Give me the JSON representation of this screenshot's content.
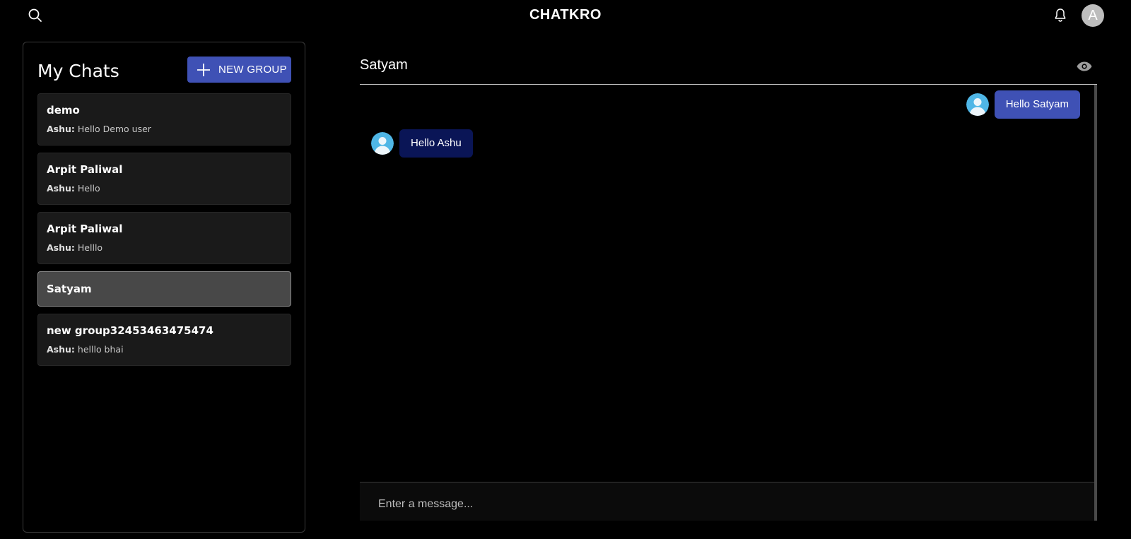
{
  "app": {
    "title": "CHATKRO",
    "avatar_letter": "A"
  },
  "sidebar": {
    "title": "My Chats",
    "new_group_label": "NEW GROUP",
    "chats": [
      {
        "name": "demo",
        "sender": "Ashu:",
        "preview": "Hello Demo user"
      },
      {
        "name": "Arpit Paliwal",
        "sender": "Ashu:",
        "preview": "Hello"
      },
      {
        "name": "Arpit Paliwal",
        "sender": "Ashu:",
        "preview": "Helllo"
      },
      {
        "name": "Satyam",
        "sender": "",
        "preview": ""
      },
      {
        "name": "new group32453463475474",
        "sender": "Ashu:",
        "preview": "helllo bhai"
      }
    ]
  },
  "chat": {
    "title": "Satyam",
    "messages": [
      {
        "text": "Hello Satyam",
        "direction": "sent"
      },
      {
        "text": "Hello Ashu",
        "direction": "received"
      }
    ],
    "input_placeholder": "Enter a message..."
  },
  "colors": {
    "accent": "#3f51b5",
    "received_bubble": "#0a1556",
    "background": "#000000"
  }
}
